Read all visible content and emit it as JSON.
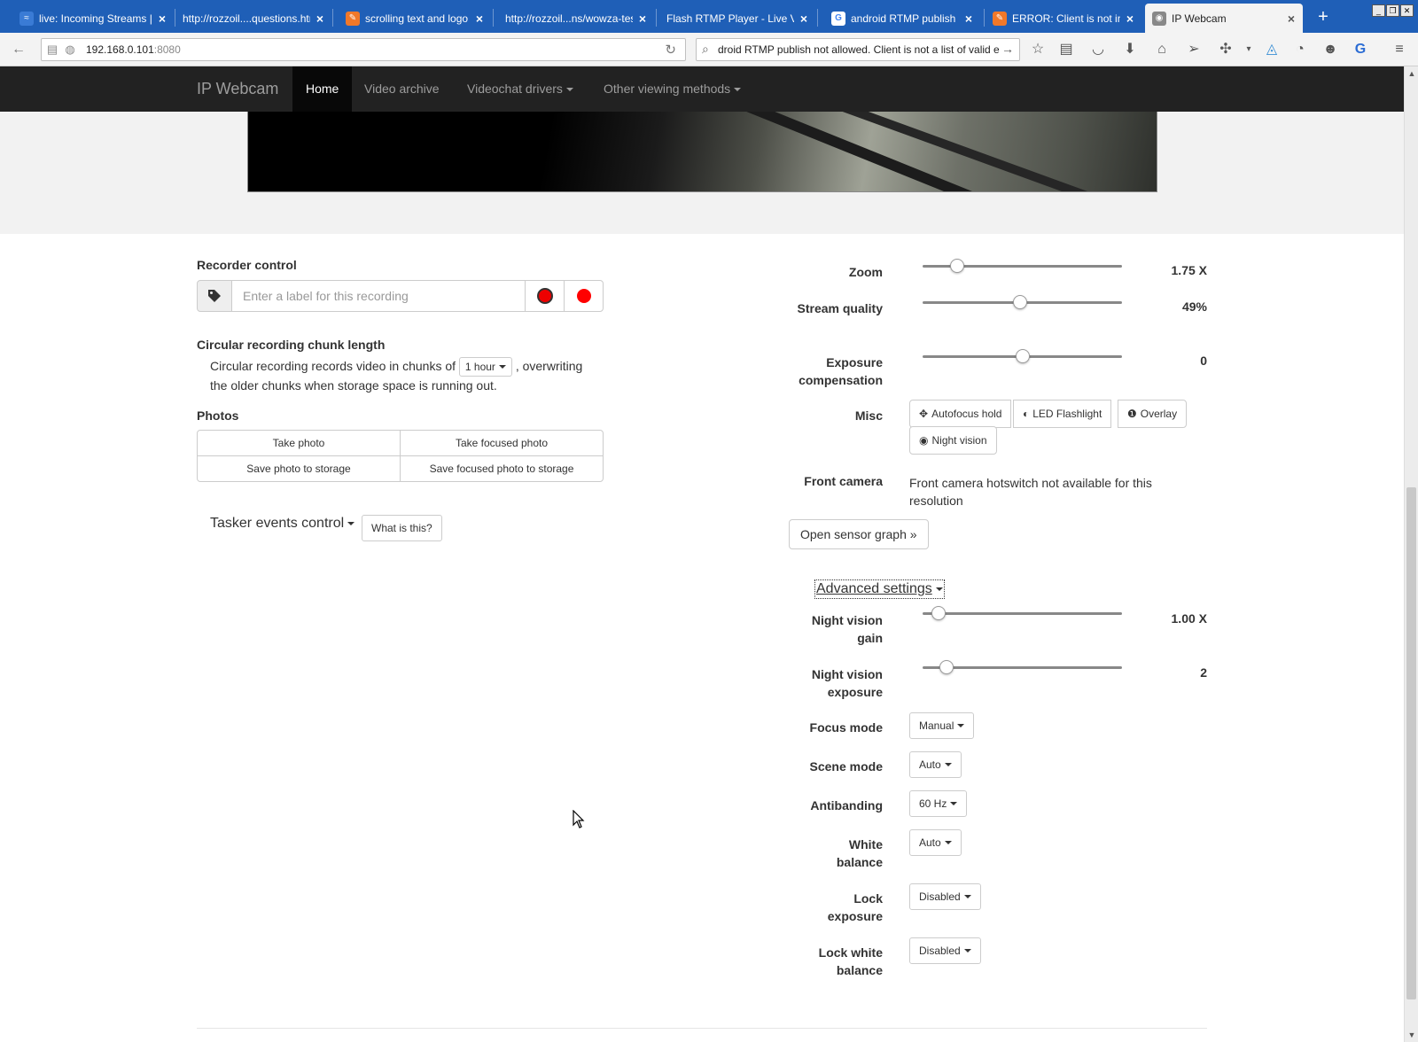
{
  "browser": {
    "tabs": [
      {
        "title": "live: Incoming Streams |...",
        "fav_color": "#3a7bd5",
        "fav_glyph": "≈",
        "active": false
      },
      {
        "title": "http://rozzoil....questions.html",
        "fav_color": "",
        "fav_glyph": "",
        "active": false
      },
      {
        "title": "scrolling text and logo i...",
        "fav_color": "#f0782a",
        "fav_glyph": "✎",
        "active": false
      },
      {
        "title": "http://rozzoil...ns/wowza-test/",
        "fav_color": "",
        "fav_glyph": "",
        "active": false
      },
      {
        "title": "Flash RTMP Player - Live Vid...",
        "fav_color": "",
        "fav_glyph": "",
        "active": false
      },
      {
        "title": "android RTMP publish n...",
        "fav_color": "#ffffff",
        "fav_glyph": "G",
        "active": false
      },
      {
        "title": "ERROR: Client is not in l...",
        "fav_color": "#f0782a",
        "fav_glyph": "✎",
        "active": false
      },
      {
        "title": "IP Webcam",
        "fav_color": "#888888",
        "fav_glyph": "◉",
        "active": true
      }
    ],
    "url_host": "192.168.0.101",
    "url_port": ":8080",
    "search_text": "droid RTMP publish not allowed. Client is not a list of valid encoders"
  },
  "site": {
    "brand": "IP Webcam",
    "nav": [
      {
        "label": "Home",
        "active": true,
        "dropdown": false
      },
      {
        "label": "Video archive",
        "active": false,
        "dropdown": false
      },
      {
        "label": "Videochat drivers",
        "active": false,
        "dropdown": true
      },
      {
        "label": "Other viewing methods",
        "active": false,
        "dropdown": true
      }
    ]
  },
  "recorder": {
    "title": "Recorder control",
    "label_placeholder": "Enter a label for this recording"
  },
  "circular": {
    "title": "Circular recording chunk length",
    "text_before": "Circular recording records video in chunks of",
    "chunk_value": "1 hour",
    "text_after": ", overwriting",
    "text_line2": "the older chunks when storage space is running out."
  },
  "photos": {
    "title": "Photos",
    "take": "Take photo",
    "take_focused": "Take focused photo",
    "save": "Save photo to storage",
    "save_focused": "Save focused photo to storage"
  },
  "tasker": {
    "label": "Tasker events control",
    "help": "What is this?"
  },
  "controls": {
    "zoom": {
      "label": "Zoom",
      "value": "1.75 X",
      "position": 0.15
    },
    "quality": {
      "label": "Stream quality",
      "value": "49%",
      "position": 0.49
    },
    "exposure": {
      "label": "Exposure compensation",
      "value": "0",
      "position": 0.5
    },
    "misc": {
      "label": "Misc",
      "autofocus": "Autofocus hold",
      "flashlight": "LED Flashlight",
      "overlay": "Overlay",
      "night": "Night vision"
    },
    "front": {
      "label": "Front camera",
      "text": "Front camera hotswitch not available for this resolution"
    },
    "sensor_button": "Open sensor graph »",
    "advanced": "Advanced settings",
    "night_gain": {
      "label": "Night vision gain",
      "value": "1.00 X",
      "position": 0.05
    },
    "night_exposure": {
      "label": "Night vision exposure",
      "value": "2",
      "position": 0.09
    },
    "focus_mode": {
      "label": "Focus mode",
      "value": "Manual"
    },
    "scene_mode": {
      "label": "Scene mode",
      "value": "Auto"
    },
    "antibanding": {
      "label": "Antibanding",
      "value": "60 Hz"
    },
    "white_balance": {
      "label": "White balance",
      "value": "Auto"
    },
    "lock_exposure": {
      "label": "Lock exposure",
      "value": "Disabled"
    },
    "lock_wb": {
      "label": "Lock white balance",
      "value": "Disabled"
    }
  },
  "colors": {
    "tabbar": "#1f5fb7",
    "site_nav": "#222222",
    "record_red": "#ff0000"
  }
}
